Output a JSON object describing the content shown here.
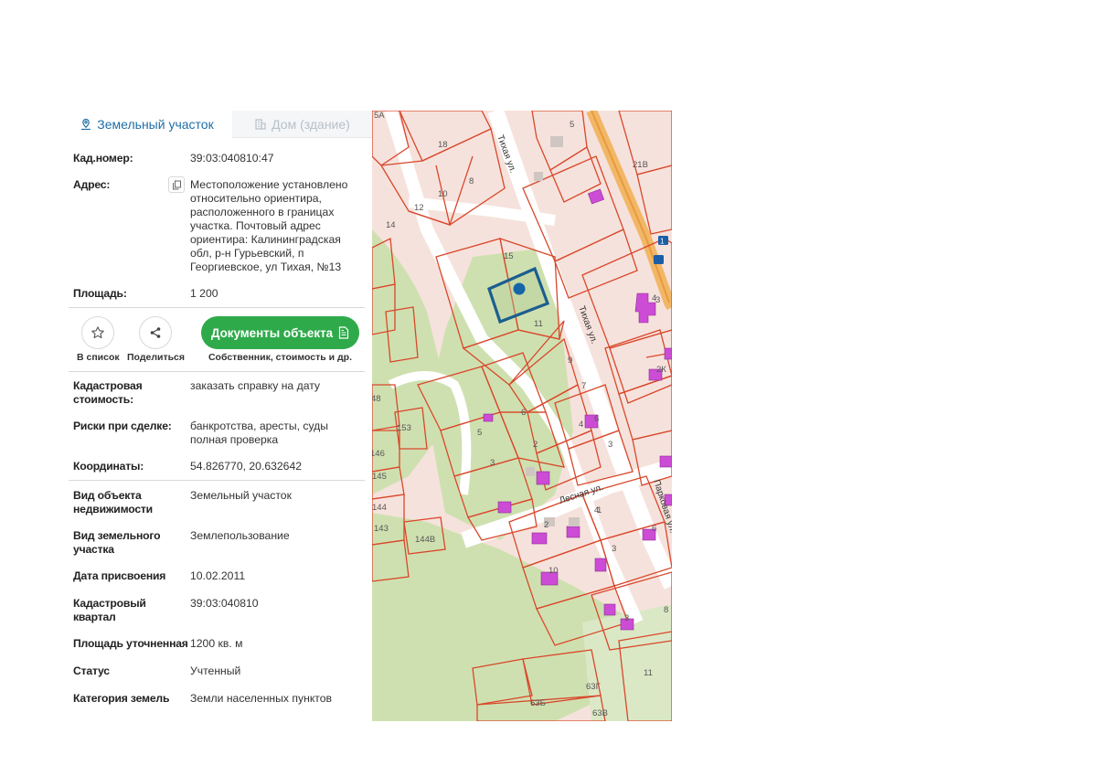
{
  "tabs": {
    "active_label": "Земельный участок",
    "inactive_label": "Дом (здание)"
  },
  "property": {
    "cadastral_number_label": "Кад.номер:",
    "cadastral_number": "39:03:040810:47",
    "address_label": "Адрес:",
    "address": "Местоположение установлено относительно ориентира, расположенного в границах участка. Почтовый адрес ориентира: Калининградская обл, р-н Гурьевский, п Георгиевское, ул Тихая, №13",
    "area_label": "Площадь:",
    "area": "1 200"
  },
  "actions": {
    "favorites_label": "В список",
    "share_label": "Поделиться",
    "docs_button_label": "Документы объекта",
    "docs_sub_label": "Собственник, стоимость и др."
  },
  "details": {
    "cadastral_value_label": "Кадастровая стоимость:",
    "cadastral_value_link": "заказать справку на дату",
    "risks_label": "Риски при сделке:",
    "risks_value": "банкротства, аресты, суды",
    "risks_link": "полная проверка",
    "coordinates_label": "Координаты:",
    "coordinates": "54.826770, 20.632642"
  },
  "attributes": [
    {
      "label": "Вид объекта недвижимости",
      "value": "Земельный участок"
    },
    {
      "label": "Вид земельного участка",
      "value": "Землепользование"
    },
    {
      "label": "Дата присвоения",
      "value": "10.02.2011"
    },
    {
      "label": "Кадастровый квартал",
      "value": "39:03:040810"
    },
    {
      "label": "Площадь уточненная",
      "value": "1200 кв. м"
    },
    {
      "label": "Статус",
      "value": "Учтенный"
    },
    {
      "label": "Категория земель",
      "value": "Земли населенных пунктов"
    }
  ],
  "map": {
    "parcel_numbers": [
      "5А",
      "5",
      "18",
      "10",
      "8",
      "12",
      "21В",
      "14",
      "15",
      "11",
      "9",
      "7",
      "3",
      "6",
      "5",
      "4",
      "2",
      "3",
      "1",
      "153",
      "146",
      "145",
      "144",
      "143",
      "144В",
      "11",
      "63Г",
      "63Б",
      "63В",
      "2К",
      "3",
      "6",
      "4",
      "10",
      "4",
      "3",
      "2",
      "3",
      "8",
      "6",
      "48"
    ],
    "street_labels": [
      "Тихая ул.",
      "Тихая ул.",
      "Лесная ул.",
      "Парковая ул."
    ],
    "road_marker": "1",
    "colors": {
      "parcel_border": "#d9472b",
      "parcel_fill": "#f6e2dc",
      "green_area": "#cfe0b0",
      "road": "#ffffff",
      "building": "#cc4cd6",
      "selected_border": "#1b5e8f",
      "selected_dot": "#1665a6",
      "highway": "#f2b766"
    }
  }
}
